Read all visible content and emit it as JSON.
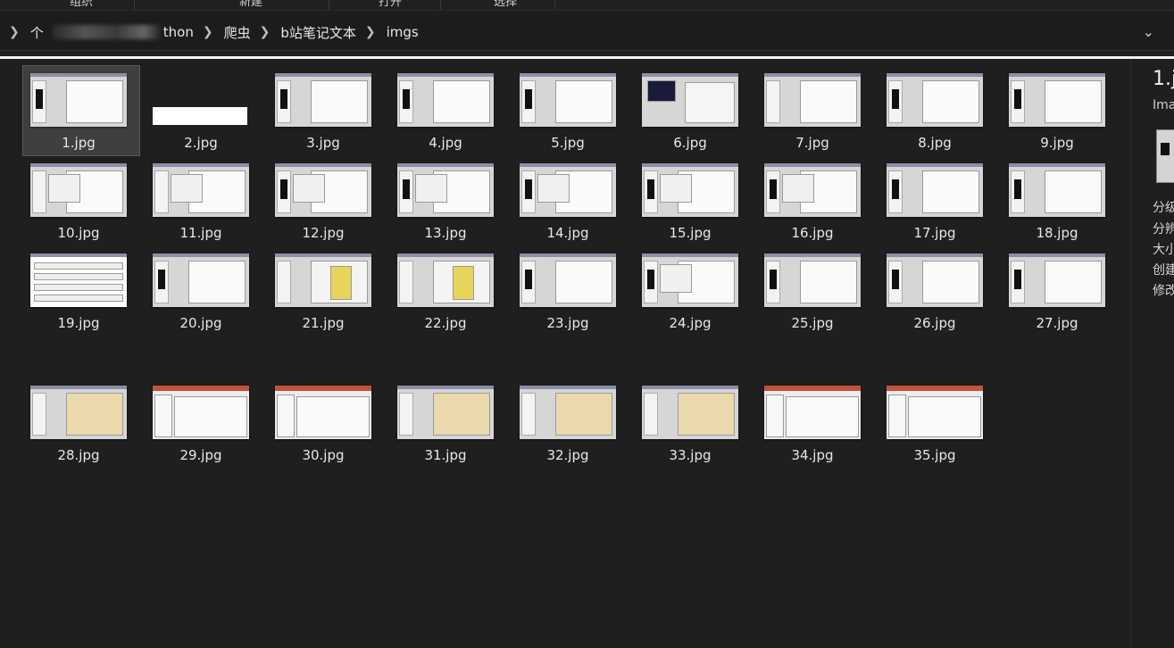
{
  "ribbon": {
    "groups": [
      "组织",
      "新建",
      "打开",
      "选择"
    ]
  },
  "address": {
    "crumbs": [
      "个",
      "thon",
      "爬虫",
      "b站笔记文本",
      "imgs"
    ],
    "dropdown_icon": "chevron-down-icon"
  },
  "files": [
    {
      "name": "1.jpg",
      "style": "chart-win",
      "selected": true
    },
    {
      "name": "2.jpg",
      "style": "text-strip"
    },
    {
      "name": "3.jpg",
      "style": "chart-win"
    },
    {
      "name": "4.jpg",
      "style": "chart-win"
    },
    {
      "name": "5.jpg",
      "style": "chart-win"
    },
    {
      "name": "6.jpg",
      "style": "dark-panel"
    },
    {
      "name": "7.jpg",
      "style": "line-chart"
    },
    {
      "name": "8.jpg",
      "style": "chart-win"
    },
    {
      "name": "9.jpg",
      "style": "chart-win"
    },
    {
      "name": "10.jpg",
      "style": "table-win"
    },
    {
      "name": "11.jpg",
      "style": "dialog"
    },
    {
      "name": "12.jpg",
      "style": "dialog-black"
    },
    {
      "name": "13.jpg",
      "style": "dialog-black"
    },
    {
      "name": "14.jpg",
      "style": "dialog-black"
    },
    {
      "name": "15.jpg",
      "style": "dialog-black"
    },
    {
      "name": "16.jpg",
      "style": "dialog-black"
    },
    {
      "name": "17.jpg",
      "style": "chart-win"
    },
    {
      "name": "18.jpg",
      "style": "chart-win"
    },
    {
      "name": "19.jpg",
      "style": "doc"
    },
    {
      "name": "20.jpg",
      "style": "chart-win"
    },
    {
      "name": "21.jpg",
      "style": "yellow-plot"
    },
    {
      "name": "22.jpg",
      "style": "yellow-plot"
    },
    {
      "name": "23.jpg",
      "style": "chart-win"
    },
    {
      "name": "24.jpg",
      "style": "dialog-black"
    },
    {
      "name": "25.jpg",
      "style": "chart-win"
    },
    {
      "name": "26.jpg",
      "style": "chart-win"
    },
    {
      "name": "27.jpg",
      "style": "chart-win"
    },
    {
      "name": "28.jpg",
      "style": "paper"
    },
    {
      "name": "29.jpg",
      "style": "ppt"
    },
    {
      "name": "30.jpg",
      "style": "ppt"
    },
    {
      "name": "31.jpg",
      "style": "paper"
    },
    {
      "name": "32.jpg",
      "style": "paper"
    },
    {
      "name": "33.jpg",
      "style": "paper"
    },
    {
      "name": "34.jpg",
      "style": "ppt"
    },
    {
      "name": "35.jpg",
      "style": "ppt"
    }
  ],
  "preview": {
    "name": "1.j",
    "type": "Ima",
    "props": [
      "分级",
      "分辨",
      "大小",
      "创建",
      "修改"
    ]
  }
}
